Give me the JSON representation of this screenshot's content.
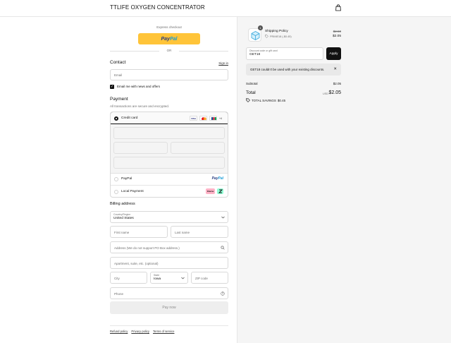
{
  "header": {
    "store_name": "TTLIFE OXYGEN CONCENTRATOR",
    "cart_icon": "bag-icon"
  },
  "express": {
    "label": "Express checkout",
    "paypal_pay": "Pay",
    "paypal_pal": "Pal",
    "or_text": "OR"
  },
  "contact": {
    "title": "Contact",
    "sign_in": "Sign in",
    "email_placeholder": "Email",
    "newsletter_label": "Email me with news and offers",
    "newsletter_checked": true
  },
  "payment": {
    "title": "Payment",
    "subtitle": "All transactions are secure and encrypted.",
    "options": [
      {
        "label": "Credit card",
        "selected": true
      },
      {
        "label": "PayPal",
        "selected": false
      },
      {
        "label": "Local Payment",
        "selected": false
      }
    ],
    "card_brands": [
      "VISA",
      "MC",
      "JCB"
    ],
    "more_cards": "+4",
    "paypal_mark_pay": "Pay",
    "paypal_mark_pal": "Pal",
    "klarna": "Klarna"
  },
  "billing": {
    "title": "Billing address",
    "country_label": "Country/Region",
    "country_value": "United States",
    "first_name": "First name",
    "last_name": "Last name",
    "address": "Address (We do not support PO Box address.)",
    "apartment": "Apartment, suite, etc. (optional)",
    "city": "City",
    "state_label": "State",
    "state_value": "Iowa",
    "zip": "ZIP code",
    "phone": "Phone"
  },
  "pay_now": "Pay now",
  "footer": {
    "links": [
      "Refund policy",
      "Privacy policy",
      "Terms of service"
    ]
  },
  "summary": {
    "product": {
      "name": "Shipping Policy",
      "quantity": "1",
      "discount_tag": "PRIME18 (-$0.45)",
      "price_original": "$2.50",
      "price_final": "$2.05"
    },
    "discount": {
      "label": "Discount code or gift card",
      "value": "GET18",
      "apply": "Apply"
    },
    "error": "GET18 couldn't be used with your existing discounts.",
    "subtotal_label": "Subtotal",
    "subtotal_value": "$2.05",
    "total_label": "Total",
    "currency": "USD",
    "total_value": "$2.05",
    "savings_label": "TOTAL SAVINGS",
    "savings_value": "$0.45"
  }
}
